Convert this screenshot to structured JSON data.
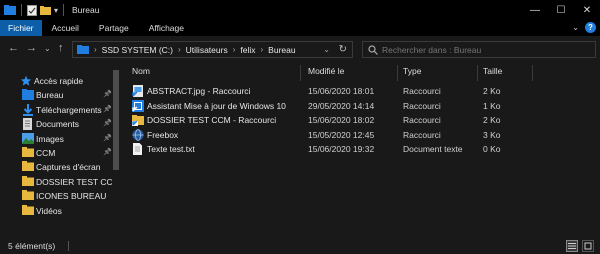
{
  "window": {
    "title": "Bureau",
    "controls": [
      "—",
      "☐",
      "✕"
    ]
  },
  "ribbon": {
    "tabs": [
      "Fichier",
      "Accueil",
      "Partage",
      "Affichage"
    ]
  },
  "address": {
    "crumbs": [
      "SSD SYSTEM (C:)",
      "Utilisateurs",
      "felix",
      "Bureau"
    ],
    "search_placeholder": "Rechercher dans : Bureau"
  },
  "sidebar": {
    "items": [
      {
        "label": "Accès rapide",
        "icon": "star-icon",
        "pinned": false,
        "level": 0
      },
      {
        "label": "Bureau",
        "icon": "desktop-icon",
        "pinned": true,
        "level": 1
      },
      {
        "label": "Téléchargements",
        "icon": "download-icon",
        "pinned": true,
        "level": 1
      },
      {
        "label": "Documents",
        "icon": "documents-icon",
        "pinned": true,
        "level": 1
      },
      {
        "label": "Images",
        "icon": "images-icon",
        "pinned": true,
        "level": 1
      },
      {
        "label": "CCM",
        "icon": "folder-icon",
        "pinned": true,
        "level": 1
      },
      {
        "label": "Captures d'écran",
        "icon": "folder-icon",
        "pinned": false,
        "level": 1
      },
      {
        "label": "DOSSIER TEST CCM",
        "icon": "folder-icon",
        "pinned": false,
        "level": 1
      },
      {
        "label": "ICONES BUREAU",
        "icon": "folder-icon",
        "pinned": false,
        "level": 1
      },
      {
        "label": "Vidéos",
        "icon": "folder-icon",
        "pinned": false,
        "level": 1
      }
    ]
  },
  "list": {
    "columns": [
      "Nom",
      "Modifié le",
      "Type",
      "Taille"
    ],
    "rows": [
      {
        "name": "ABSTRACT.jpg - Raccourci",
        "modified": "15/06/2020 18:01",
        "type": "Raccourci",
        "size": "2 Ko",
        "icon": "image-shortcut-icon"
      },
      {
        "name": "Assistant Mise à jour de Windows 10",
        "modified": "29/05/2020 14:14",
        "type": "Raccourci",
        "size": "1 Ko",
        "icon": "app-shortcut-icon"
      },
      {
        "name": "DOSSIER TEST CCM - Raccourci",
        "modified": "15/06/2020 18:02",
        "type": "Raccourci",
        "size": "2 Ko",
        "icon": "folder-shortcut-icon"
      },
      {
        "name": "Freebox",
        "modified": "15/05/2020 12:45",
        "type": "Raccourci",
        "size": "3 Ko",
        "icon": "network-shortcut-icon"
      },
      {
        "name": "Texte test.txt",
        "modified": "15/06/2020 19:32",
        "type": "Document texte",
        "size": "0 Ko",
        "icon": "text-file-icon"
      }
    ]
  },
  "status": {
    "count": "5 élément(s)"
  },
  "colors": {
    "accent": "#0c5ea8",
    "folder": "#e8b73d",
    "background": "#191919"
  }
}
